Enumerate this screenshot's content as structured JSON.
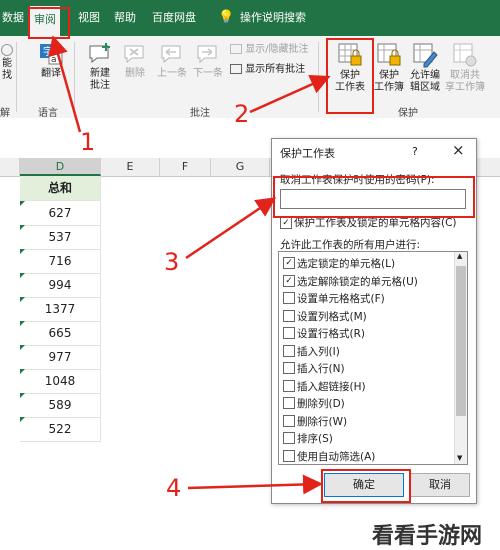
{
  "ribbon_tabs": [
    "数据",
    "审阅",
    "视图",
    "帮助",
    "百度网盘",
    "操作说明搜索"
  ],
  "ribbon": {
    "left_partial": {
      "top": "能",
      "bottom": "找",
      "label": "解"
    },
    "translate": "翻译",
    "language_group": "语言",
    "new_comment_l1": "新建",
    "new_comment_l2": "批注",
    "delete": "删除",
    "previous": "上一条",
    "next": "下一条",
    "show_hide_comment": "显示/隐藏批注",
    "show_all_comments": "显示所有批注",
    "comments_group": "批注",
    "protect_sheet_l1": "保护",
    "protect_sheet_l2": "工作表",
    "protect_workbook_l1": "保护",
    "protect_workbook_l2": "工作簿",
    "allow_edit_l1": "允许编",
    "allow_edit_l2": "辑区域",
    "unshare_l1": "取消共",
    "unshare_l2": "享工作簿",
    "protect_group": "保护"
  },
  "columns": [
    "D",
    "E",
    "F",
    "G"
  ],
  "sheet": {
    "header": "总和",
    "values": [
      "627",
      "537",
      "716",
      "994",
      "1377",
      "665",
      "977",
      "1048",
      "589",
      "522"
    ]
  },
  "dialog": {
    "title": "保护工作表",
    "help": "?",
    "close": "×",
    "password_label": "取消工作表保护时使用的密码(P):",
    "password_value": "",
    "protect_check_label": "保护工作表及锁定的单元格内容(C)",
    "allow_label": "允许此工作表的所有用户进行:",
    "options": [
      {
        "label": "选定锁定的单元格(L)",
        "checked": true
      },
      {
        "label": "选定解除锁定的单元格(U)",
        "checked": true
      },
      {
        "label": "设置单元格格式(F)",
        "checked": false
      },
      {
        "label": "设置列格式(M)",
        "checked": false
      },
      {
        "label": "设置行格式(R)",
        "checked": false
      },
      {
        "label": "插入列(I)",
        "checked": false
      },
      {
        "label": "插入行(N)",
        "checked": false
      },
      {
        "label": "插入超链接(H)",
        "checked": false
      },
      {
        "label": "删除列(D)",
        "checked": false
      },
      {
        "label": "删除行(W)",
        "checked": false
      },
      {
        "label": "排序(S)",
        "checked": false
      },
      {
        "label": "使用自动筛选(A)",
        "checked": false
      }
    ],
    "ok": "确定",
    "cancel": "取消"
  },
  "annotations": [
    "1",
    "2",
    "3",
    "4"
  ],
  "watermark": "看看手游网",
  "colors": {
    "excel_green": "#217346",
    "annotation_red": "#e2231a"
  }
}
